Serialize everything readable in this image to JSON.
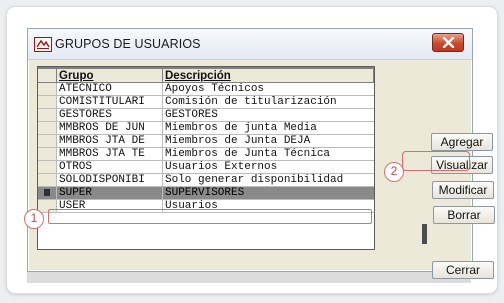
{
  "window": {
    "title": "GRUPOS DE USUARIOS"
  },
  "table": {
    "columns": [
      "Grupo",
      "Descripción"
    ],
    "rows": [
      {
        "grupo": "ATECNICO",
        "descripcion": "Apoyos Técnicos"
      },
      {
        "grupo": "COMISTITULARI",
        "descripcion": "Comisión de titularización"
      },
      {
        "grupo": "GESTORES",
        "descripcion": "GESTORES"
      },
      {
        "grupo": "MMBROS DE JUN",
        "descripcion": "Miembros de junta Media"
      },
      {
        "grupo": "MMBROS JTA DE",
        "descripcion": "Miembros de Junta DEJA"
      },
      {
        "grupo": "MMBROS JTA TE",
        "descripcion": "Miembros de Junta Técnica"
      },
      {
        "grupo": "OTROS",
        "descripcion": "Usuarios Externos"
      },
      {
        "grupo": "SOLODISPONIBI",
        "descripcion": "Solo generar disponibilidad"
      },
      {
        "grupo": "SUPER",
        "descripcion": "SUPERVISORES",
        "selected": true
      },
      {
        "grupo": "USER",
        "descripcion": "Usuarios"
      }
    ]
  },
  "buttons": {
    "agregar": "Agregar",
    "visualizar": "Visualizar",
    "modificar": "Modificar",
    "borrar": "Borrar",
    "cerrar": "Cerrar"
  },
  "annotations": {
    "step1": "1",
    "step2": "2"
  },
  "colors": {
    "highlight": "#d76f6f",
    "selected_row": "#8a8a8a",
    "close_button": "#c94a2f"
  }
}
